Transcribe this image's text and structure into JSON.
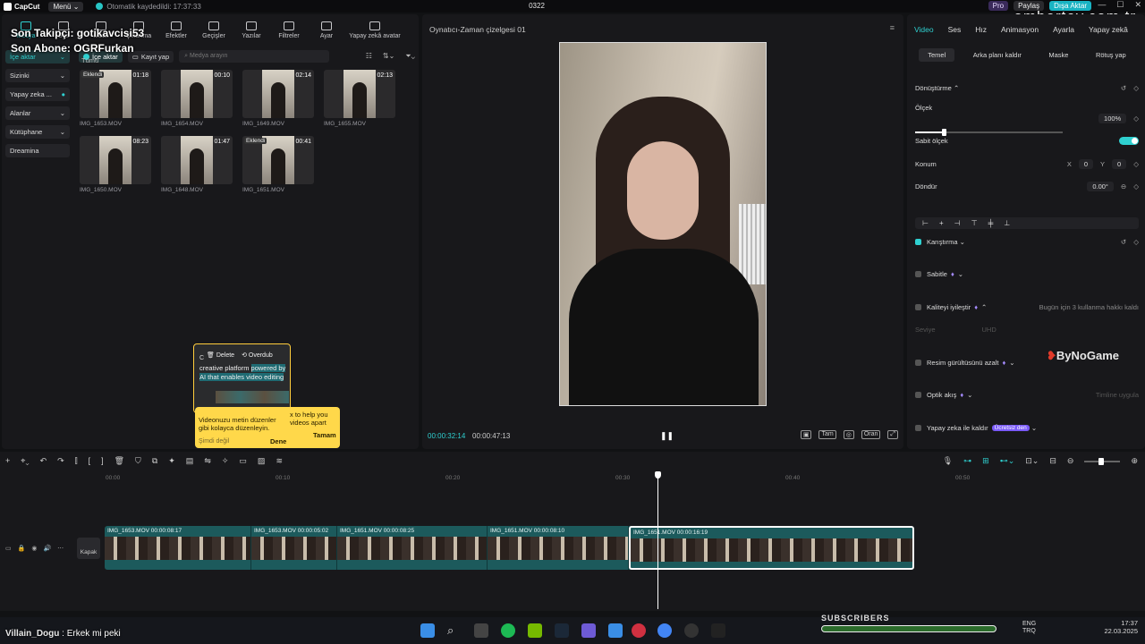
{
  "titlebar": {
    "app": "CapCut",
    "menu": "Menü",
    "autosave": "Otomatik kaydedildi: 17:37:33",
    "project": "0322",
    "pro": "Pro",
    "share": "Paylaş",
    "export": "Dışa Aktar",
    "watermark": "ambertey.com.tr"
  },
  "overlay": {
    "follower": "Son Takipçi: gotikavcisi53",
    "subscriber": "Son Abone: OGRFurkan"
  },
  "tools": [
    "Medya",
    "Ses",
    "Metin",
    "Çıkartma",
    "Efektler",
    "Geçişler",
    "Yazılar",
    "Filtreler",
    "Ayar",
    "Yapay zekâ avatar"
  ],
  "sidebar": [
    {
      "label": "İçe aktar",
      "caret": "⌄"
    },
    {
      "label": "Sizinki",
      "caret": "⌄"
    },
    {
      "label": "Yapay zeka ...",
      "caret": "●"
    },
    {
      "label": "Alanlar",
      "caret": "⌄"
    },
    {
      "label": "Kütüphane",
      "caret": "⌄"
    },
    {
      "label": "Dreamina",
      "caret": ""
    }
  ],
  "media": {
    "import": "İçe aktar",
    "record": "Kayıt yap",
    "search_placeholder": "Medya arayın",
    "section": "Tümü",
    "items": [
      {
        "name": "IMG_1653.MOV",
        "dur": "01:18",
        "added": "Eklendi"
      },
      {
        "name": "IMG_1654.MOV",
        "dur": "00:10",
        "added": ""
      },
      {
        "name": "IMG_1649.MOV",
        "dur": "02:14",
        "added": ""
      },
      {
        "name": "IMG_1655.MOV",
        "dur": "02:13",
        "added": ""
      },
      {
        "name": "IMG_1650.MOV",
        "dur": "08:23",
        "added": ""
      },
      {
        "name": "IMG_1648.MOV",
        "dur": "01:47",
        "added": ""
      },
      {
        "name": "IMG_1651.MOV",
        "dur": "00:41",
        "added": "Eklendi"
      }
    ]
  },
  "tip": {
    "delete": "Delete",
    "overdub": "Overdub",
    "c": "C",
    "text_a": "creative platform ",
    "text_b": "powered by AI that enables video editing",
    "desc": "Videonuzu metin düzenler gibi kolayca düzenleyin.",
    "desc2": "x to help you videos apart",
    "later": "Şimdi değil",
    "try": "Dene",
    "ok": "Tamam"
  },
  "player": {
    "title": "Oynatıcı-Zaman çizelgesi 01",
    "current": "00:00:32:14",
    "total": "00:00:47:13",
    "full": "Tam",
    "ratio": "Oran"
  },
  "right": {
    "tabs": [
      "Video",
      "Ses",
      "Hız",
      "Animasyon",
      "Ayarla",
      "Yapay zekâ"
    ],
    "subtabs": [
      "Temel",
      "Arka planı kaldır",
      "Maske",
      "Rötuş yap"
    ],
    "transform": "Dönüştürme",
    "scale": "Ölçek",
    "scale_val": "100%",
    "fixed_scale": "Sabit ölçek",
    "position": "Konum",
    "x_label": "X",
    "x_val": "0",
    "y_label": "Y",
    "y_val": "0",
    "rotate": "Döndür",
    "rotate_val": "0.00°",
    "blend": "Karıştırma",
    "stabilize": "Sabitle",
    "enhance": "Kaliteyi iyileştir",
    "enhance_note": "Bugün için 3 kullanma hakkı kaldı",
    "level": "Seviye",
    "level_val": "UHD",
    "denoise": "Resim gürültüsünü azalt",
    "optical": "Optik akış",
    "optical_note": "Timline uygula",
    "ai_remove": "Yapay zeka ile kaldır",
    "free": "Ücretsiz den",
    "sponsor_a": "By",
    "sponsor_b": "NoGame"
  },
  "timeline": {
    "ticks": [
      "00:00",
      "00:10",
      "00:20",
      "00:30",
      "00:40",
      "00:50"
    ],
    "cover": "Kapak",
    "clips": [
      {
        "label": "IMG_1653.MOV  00:00:08:17"
      },
      {
        "label": "IMG_1653.MOV  00:00:05:02"
      },
      {
        "label": "IMG_1651.MOV  00:00:08:25"
      },
      {
        "label": "IMG_1651.MOV  00:00:08:10"
      },
      {
        "label": "IMG_1651.MOV  00:00:16:19"
      }
    ]
  },
  "stream": {
    "song_artist": "Villain_Dogu",
    "song_title": "Erkek mi peki",
    "subscribers": "SUBSCRIBERS",
    "lang1": "ENG",
    "lang2": "TRQ",
    "time": "17:37",
    "date": "22.03.2025"
  }
}
